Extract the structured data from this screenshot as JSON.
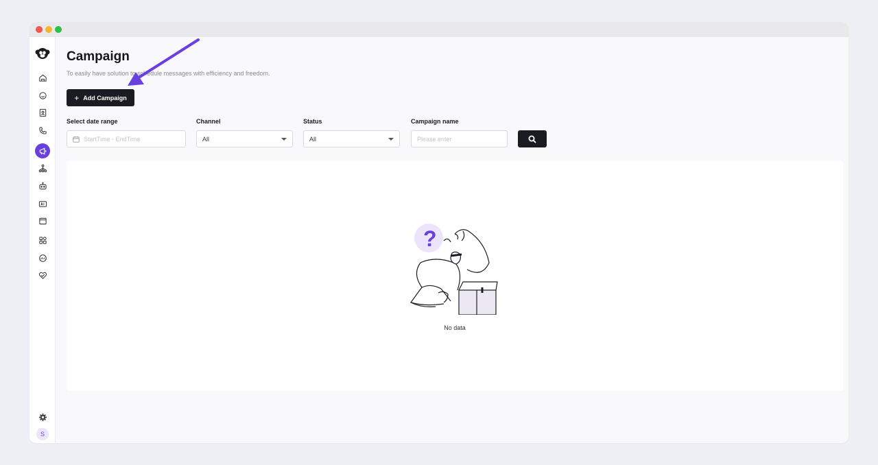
{
  "page": {
    "title": "Campaign",
    "description": "To easily have solution to schedule messages with efficiency and freedom.",
    "add_button_label": "Add Campaign"
  },
  "filters": {
    "date_range": {
      "label": "Select date range",
      "placeholder": "StartTime - EndTime"
    },
    "channel": {
      "label": "Channel",
      "value": "All"
    },
    "status": {
      "label": "Status",
      "value": "All"
    },
    "campaign_name": {
      "label": "Campaign name",
      "placeholder": "Please enter"
    }
  },
  "empty_state": {
    "text": "No data"
  },
  "user": {
    "avatar_initial": "S"
  },
  "sidebar": {
    "items": [
      {
        "icon": "home-icon"
      },
      {
        "icon": "chat-icon"
      },
      {
        "icon": "contact-card-icon"
      },
      {
        "icon": "phone-icon"
      },
      {
        "icon": "megaphone-icon",
        "active": true
      },
      {
        "icon": "flow-icon"
      },
      {
        "icon": "bot-icon"
      },
      {
        "icon": "ai-icon"
      },
      {
        "icon": "window-icon"
      },
      {
        "icon": "apps-icon"
      },
      {
        "icon": "stats-icon"
      },
      {
        "icon": "heart-icon"
      }
    ]
  },
  "colors": {
    "accent": "#6a3fe0",
    "primary_button": "#1b1c21",
    "arrow": "#6a3fe0"
  }
}
